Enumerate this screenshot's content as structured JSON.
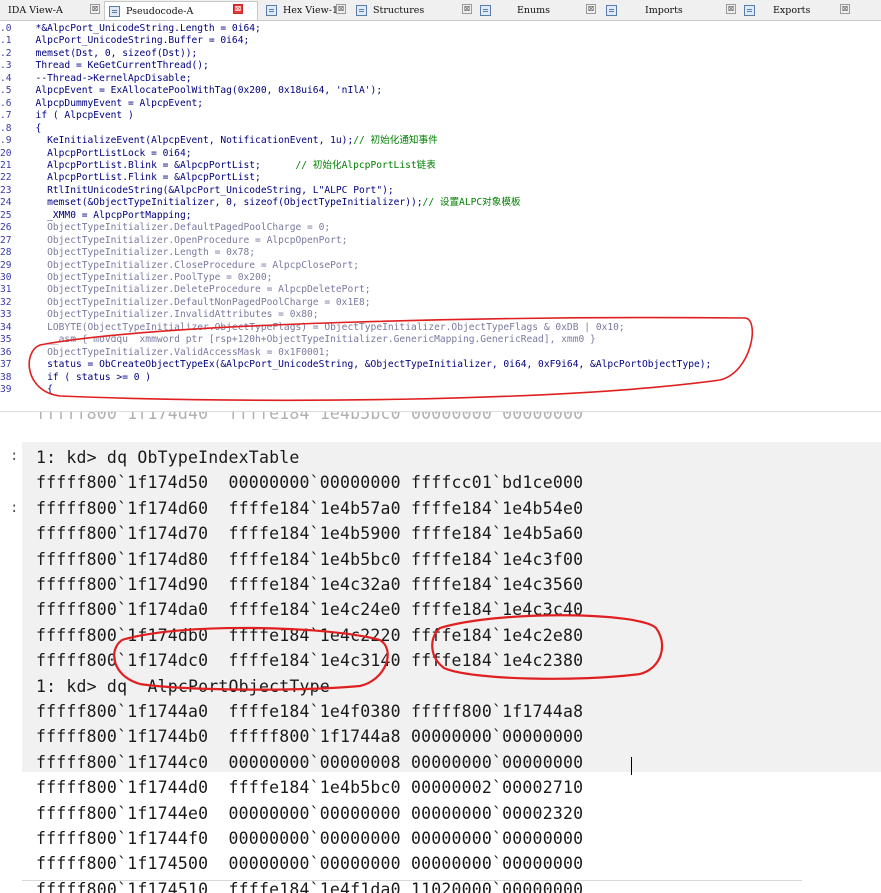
{
  "tabs": [
    {
      "label": "IDA View-A",
      "close": "⊠",
      "icon": "disassembly-icon"
    },
    {
      "label": "Pseudocode-A",
      "close": "⊠",
      "icon": "pseudocode-icon",
      "active": true
    },
    {
      "label": "Hex View-1",
      "close": "⊠",
      "icon": "hex-icon"
    },
    {
      "label": "Structures",
      "close": "⊠",
      "icon": "structures-icon"
    },
    {
      "label": "Enums",
      "close": "⊠",
      "icon": "enums-icon"
    },
    {
      "label": "Imports",
      "close": "⊠",
      "icon": "imports-icon"
    },
    {
      "label": "Exports",
      "close": "⊠",
      "icon": "exports-icon"
    }
  ],
  "code": [
    {
      "ln": ".0",
      "text": "  *&AlpcPort_UnicodeString.Length = 0i64;"
    },
    {
      "ln": ".1",
      "text": "  AlpcPort_UnicodeString.Buffer = 0i64;"
    },
    {
      "ln": ".2",
      "text": "  memset(Dst, 0, sizeof(Dst));"
    },
    {
      "ln": ".3",
      "text": "  Thread = KeGetCurrentThread();"
    },
    {
      "ln": ".4",
      "text": "  --Thread->KernelApcDisable;"
    },
    {
      "ln": ".5",
      "text": "  AlpcpEvent = ExAllocatePoolWithTag(0x200, 0x18ui64, 'nIlA');"
    },
    {
      "ln": ".6",
      "text": "  AlpcpDummyEvent = AlpcpEvent;"
    },
    {
      "ln": ".7",
      "text": "  if ( AlpcpEvent )"
    },
    {
      "ln": ".8",
      "text": "  {"
    },
    {
      "ln": ".9",
      "text": "    KeInitializeEvent(AlpcpEvent, NotificationEvent, 1u);",
      "comment": "// 初始化通知事件"
    },
    {
      "ln": "20",
      "text": "    AlpcpPortListLock = 0i64;"
    },
    {
      "ln": "21",
      "text": "    AlpcpPortList.Blink = &AlpcpPortList;      ",
      "comment": "// 初始化AlpcpPortList链表"
    },
    {
      "ln": "22",
      "text": "    AlpcpPortList.Flink = &AlpcpPortList;"
    },
    {
      "ln": "23",
      "text": "    RtlInitUnicodeString(&AlpcPort_UnicodeString, L\"ALPC Port\");"
    },
    {
      "ln": "24",
      "text": "    memset(&ObjectTypeInitializer, 0, sizeof(ObjectTypeInitializer));",
      "comment": "// 设置ALPC对象模板"
    },
    {
      "ln": "25",
      "text": "    _XMM0 = AlpcpPortMapping;"
    },
    {
      "ln": "26",
      "text": "    ObjectTypeInitializer.DefaultPagedPoolCharge = 0;"
    },
    {
      "ln": "27",
      "text": "    ObjectTypeInitializer.OpenProcedure = AlpcpOpenPort;"
    },
    {
      "ln": "28",
      "text": "    ObjectTypeInitializer.Length = 0x78;"
    },
    {
      "ln": "29",
      "text": "    ObjectTypeInitializer.CloseProcedure = AlpcpClosePort;"
    },
    {
      "ln": "30",
      "text": "    ObjectTypeInitializer.PoolType = 0x200;"
    },
    {
      "ln": "31",
      "text": "    ObjectTypeInitializer.DeleteProcedure = AlpcpDeletePort;"
    },
    {
      "ln": "32",
      "text": "    ObjectTypeInitializer.DefaultNonPagedPoolCharge = 0x1E8;"
    },
    {
      "ln": "33",
      "text": "    ObjectTypeInitializer.InvalidAttributes = 0x80;"
    },
    {
      "ln": "34",
      "text": "    LOBYTE(ObjectTypeInitializer.ObjectTypeFlags) = ObjectTypeInitializer.ObjectTypeFlags & 0xDB | 0x10;"
    },
    {
      "ln": "35",
      "text": "    __asm { movdqu  xmmword ptr [rsp+120h+ObjectTypeInitializer.GenericMapping.GenericRead], xmm0 }"
    },
    {
      "ln": "36",
      "text": "    ObjectTypeInitializer.ValidAccessMask = 0x1F0001;"
    },
    {
      "ln": "37",
      "text": "    status = ObCreateObjectTypeEx(&AlpcPort_UnicodeString, &ObjectTypeInitializer, 0i64, 0xF9i64, &AlpcPortObjectType);"
    },
    {
      "ln": "38",
      "text": "    if ( status >= 0 )"
    },
    {
      "ln": "39",
      "text": "    {"
    }
  ],
  "debugger": {
    "faded_top": "fffff800`1f174d40  ffffe184`1e4b5bc0 00000000`00000000",
    "gutter_marks": [
      ":",
      ":"
    ],
    "lines": [
      "1: kd> dq ObTypeIndexTable",
      "fffff800`1f174d50  00000000`00000000 ffffcc01`bd1ce000",
      "fffff800`1f174d60  ffffe184`1e4b57a0 ffffe184`1e4b54e0",
      "fffff800`1f174d70  ffffe184`1e4b5900 ffffe184`1e4b5a60",
      "fffff800`1f174d80  ffffe184`1e4b5bc0 ffffe184`1e4c3f00",
      "fffff800`1f174d90  ffffe184`1e4c32a0 ffffe184`1e4c3560",
      "fffff800`1f174da0  ffffe184`1e4c24e0 ffffe184`1e4c3c40",
      "fffff800`1f174db0  ffffe184`1e4c2220 ffffe184`1e4c2e80",
      "fffff800`1f174dc0  ffffe184`1e4c3140 ffffe184`1e4c2380",
      "1: kd> dq  AlpcPortObjectType",
      "fffff800`1f1744a0  ffffe184`1e4f0380 fffff800`1f1744a8",
      "fffff800`1f1744b0  fffff800`1f1744a8 00000000`00000000",
      "fffff800`1f1744c0  00000000`00000008 00000000`00000000",
      "fffff800`1f1744d0  ffffe184`1e4b5bc0 00000002`00002710",
      "fffff800`1f1744e0  00000000`00000000 00000000`00002320",
      "fffff800`1f1744f0  00000000`00000000 00000000`00000000",
      "fffff800`1f174500  00000000`00000000 00000000`00000000",
      "fffff800`1f174510  ffffe184`1e4f1da0 11020000`00000000"
    ]
  },
  "colors": {
    "code_text": "#000080",
    "comment": "#008000",
    "annotation": "#e02020",
    "debugger_band": "#f1f1f1"
  }
}
